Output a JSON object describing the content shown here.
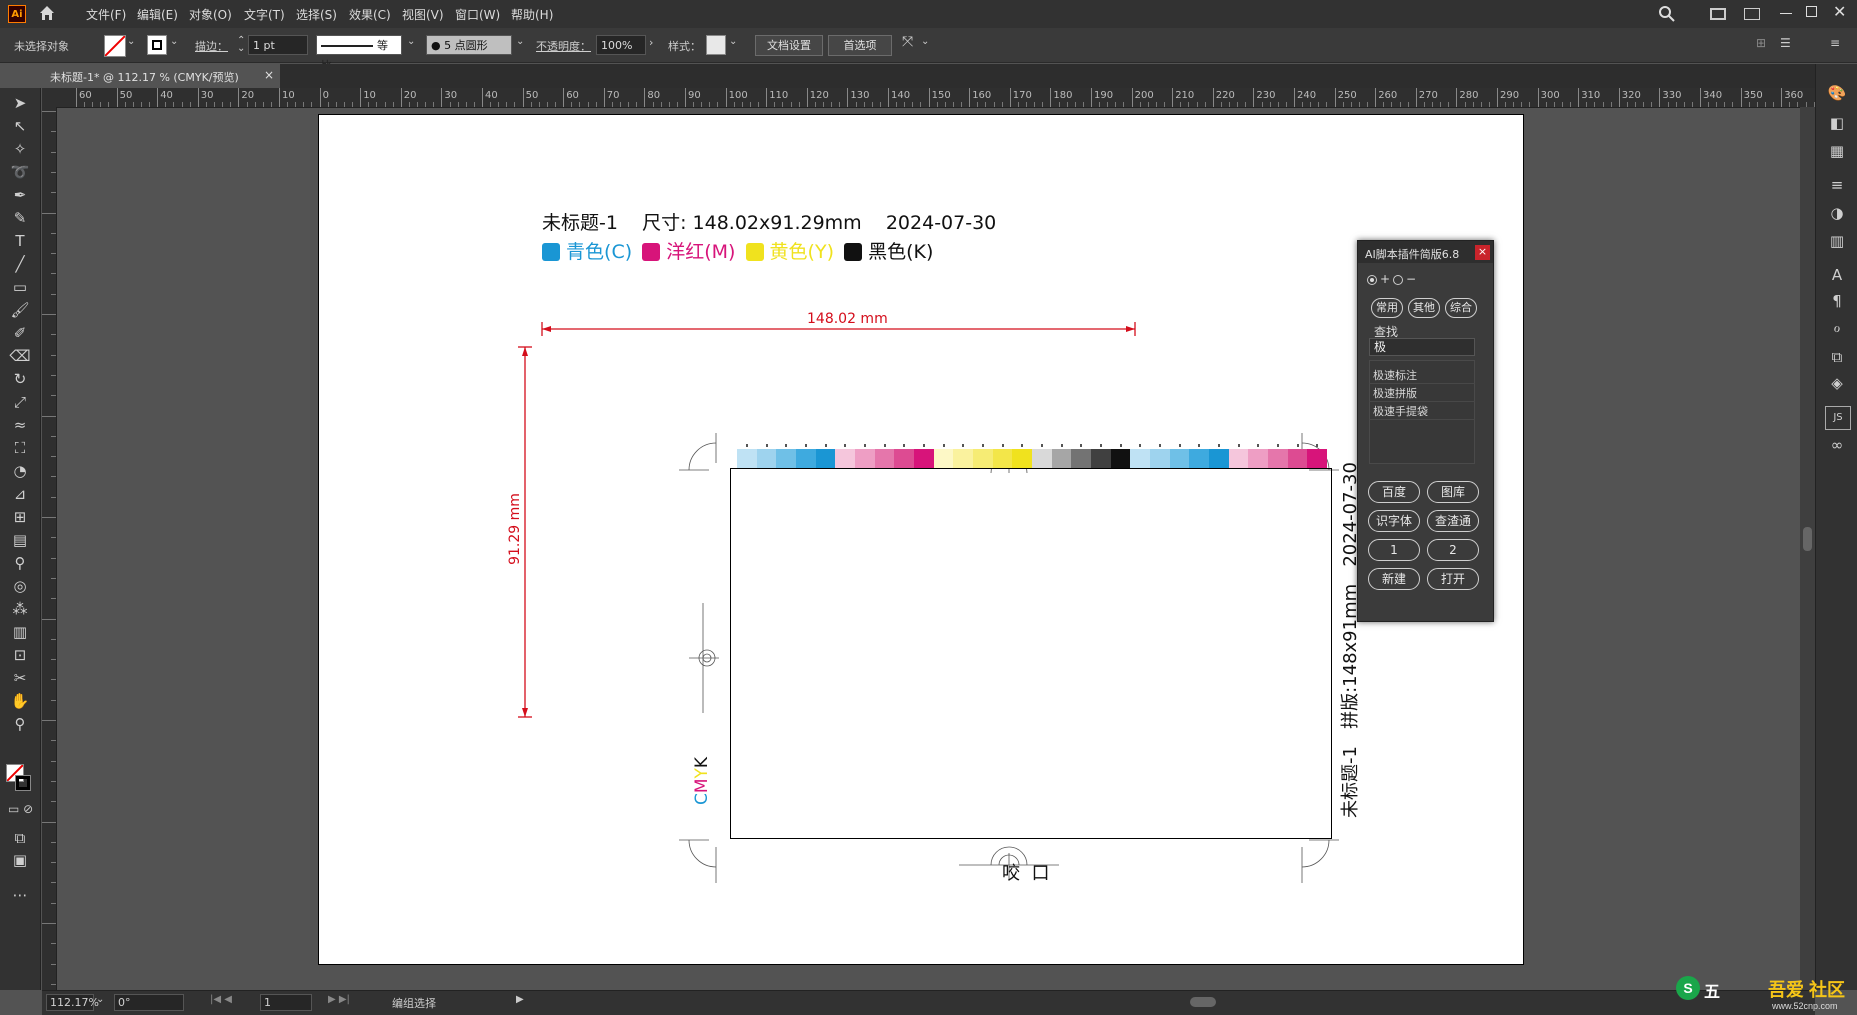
{
  "app": {
    "logo": "Ai",
    "home_icon": "home-icon"
  },
  "menu": [
    "文件(F)",
    "编辑(E)",
    "对象(O)",
    "文字(T)",
    "选择(S)",
    "效果(C)",
    "视图(V)",
    "窗口(W)",
    "帮助(H)"
  ],
  "control_bar": {
    "selection": "未选择对象",
    "stroke_label": "描边：",
    "stroke_value": "1 pt",
    "stroke_style": "等比",
    "brush": "5 点圆形",
    "opacity_label": "不透明度：",
    "opacity_value": "100%",
    "style_label": "样式：",
    "doc_setup": "文档设置",
    "preferences": "首选项"
  },
  "document_tab": {
    "title": "未标题-1* @ 112.17 % (CMYK/预览)",
    "close": "×"
  },
  "ruler_labels": [
    "60",
    "50",
    "40",
    "30",
    "20",
    "10",
    "0",
    "10",
    "20",
    "30",
    "40",
    "50",
    "60",
    "70",
    "80",
    "90",
    "100",
    "110",
    "120",
    "130",
    "140",
    "150",
    "160",
    "170",
    "180",
    "190",
    "200",
    "210",
    "220",
    "230",
    "240",
    "250",
    "260",
    "270",
    "280",
    "290",
    "300",
    "310",
    "320",
    "330",
    "340",
    "350",
    "360"
  ],
  "artwork": {
    "header": "未标题-1    尺寸: 148.02x91.29mm    2024-07-30",
    "colors": [
      {
        "label": "青色(C)",
        "color": "#1a96d4"
      },
      {
        "label": "洋红(M)",
        "color": "#d7147a"
      },
      {
        "label": "黄色(Y)",
        "color": "#f0e21e"
      },
      {
        "label": "黑色(K)",
        "color": "#111111"
      }
    ],
    "width_dim": "148.02 mm",
    "height_dim": "91.29 mm",
    "side_text": "未标题-1   拼版:148x91mm   2024-07-30",
    "cmyk": {
      "c": "C",
      "m": "M",
      "y": "Y",
      "k": "K"
    },
    "bite": "咬  口",
    "dim_color": "#d40d1b"
  },
  "color_bar": [
    "#bfe2f4",
    "#9ed3ee",
    "#6fc0e7",
    "#3eaadf",
    "#1a96d4",
    "#f5c6dc",
    "#ee9ec4",
    "#e576ab",
    "#dd4b92",
    "#d7147a",
    "#fdf8c6",
    "#faf29e",
    "#f6ec74",
    "#f3e649",
    "#f0e21e",
    "#d9d9d9",
    "#a6a6a6",
    "#737373",
    "#404040",
    "#111111",
    "#bfe2f4",
    "#9ed3ee",
    "#6fc0e7",
    "#3eaadf",
    "#1a96d4",
    "#f5c6dc",
    "#ee9ec4",
    "#e576ab",
    "#dd4b92",
    "#d7147a"
  ],
  "script_panel": {
    "title": "AI脚本插件简版6.8",
    "close": "×",
    "zoom_plus": "+",
    "zoom_minus": "−",
    "tabs": [
      "常用",
      "其他",
      "综合"
    ],
    "search_label": "查找",
    "search_value": "极",
    "results": [
      "极速标注",
      "极速拼版",
      "极速手提袋"
    ],
    "buttons": [
      "百度",
      "图库",
      "识字体",
      "查渣通",
      "1",
      "2",
      "新建",
      "打开"
    ]
  },
  "status_bar": {
    "zoom": "112.17%",
    "rotation": "0°",
    "artboard": "1",
    "status": "编组选择"
  },
  "watermark": {
    "brand": "五",
    "site": "www.52cnp.com",
    "name": "吾爱 社区"
  }
}
